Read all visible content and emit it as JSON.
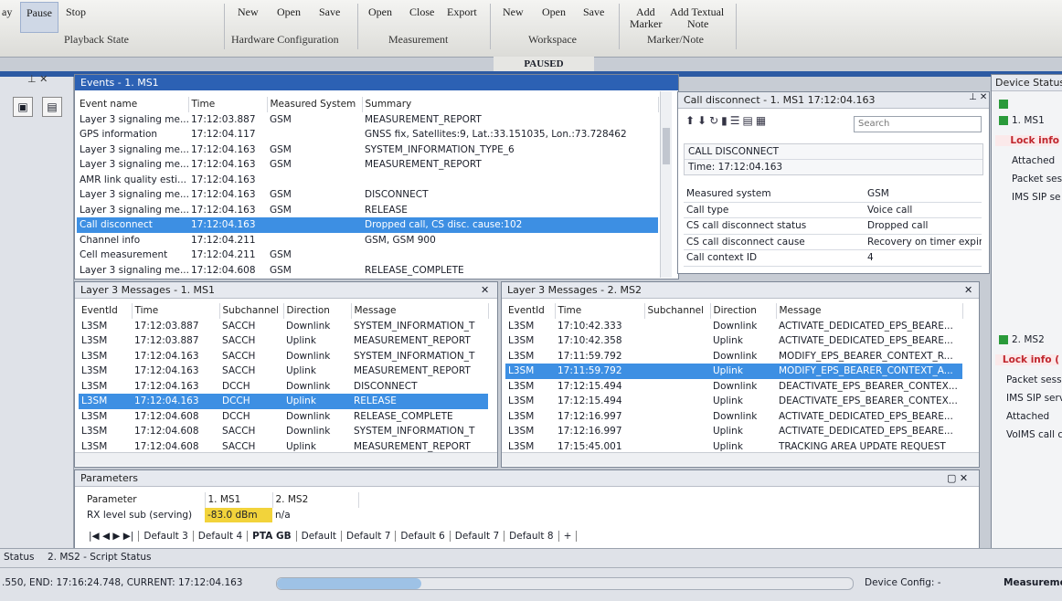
{
  "ribbon": {
    "left_cut": "ay",
    "pause": "Pause",
    "stop": "Stop",
    "playback_state": "Playback State",
    "hw_new": "New",
    "hw_open": "Open",
    "hw_save": "Save",
    "hardware_configuration": "Hardware Configuration",
    "m_open": "Open",
    "m_close": "Close",
    "m_export": "Export",
    "measurement": "Measurement",
    "ws_new": "New",
    "ws_open": "Open",
    "ws_save": "Save",
    "workspace": "Workspace",
    "add_marker_1": "Add",
    "add_marker_2": "Marker",
    "add_text_1": "Add Textual",
    "add_text_2": "Note",
    "marker_note": "Marker/Note",
    "state": "PAUSED"
  },
  "events": {
    "title": "Events - 1. MS1",
    "headers": [
      "Event name",
      "Time",
      "Measured System",
      "Summary"
    ],
    "rows": [
      [
        "Layer 3 signaling me...",
        "17:12:03.887",
        "GSM",
        "MEASUREMENT_REPORT"
      ],
      [
        "GPS information",
        "17:12:04.117",
        "",
        "GNSS fix, Satellites:9, Lat.:33.151035, Lon.:73.728462"
      ],
      [
        "Layer 3 signaling me...",
        "17:12:04.163",
        "GSM",
        "SYSTEM_INFORMATION_TYPE_6"
      ],
      [
        "Layer 3 signaling me...",
        "17:12:04.163",
        "GSM",
        "MEASUREMENT_REPORT"
      ],
      [
        "AMR link quality esti...",
        "17:12:04.163",
        "",
        ""
      ],
      [
        "Layer 3 signaling me...",
        "17:12:04.163",
        "GSM",
        "DISCONNECT"
      ],
      [
        "Layer 3 signaling me...",
        "17:12:04.163",
        "GSM",
        "RELEASE"
      ],
      [
        "Call disconnect",
        "17:12:04.163",
        "",
        "Dropped call, CS disc. cause:102"
      ],
      [
        "Channel info",
        "17:12:04.211",
        "",
        "GSM, GSM 900"
      ],
      [
        "Cell measurement",
        "17:12:04.211",
        "GSM",
        ""
      ],
      [
        "Layer 3 signaling me...",
        "17:12:04.608",
        "GSM",
        "RELEASE_COMPLETE"
      ]
    ]
  },
  "call_disconnect": {
    "title": "Call disconnect - 1. MS1  17:12:04.163",
    "search_placeholder": "Search",
    "header1": "CALL DISCONNECT",
    "header2": "Time: 17:12:04.163",
    "rows": [
      [
        "Measured system",
        "GSM"
      ],
      [
        "Call type",
        "Voice call"
      ],
      [
        "CS call disconnect status",
        "Dropped call"
      ],
      [
        "CS call disconnect cause",
        "Recovery on timer expiry"
      ],
      [
        "Call context ID",
        "4"
      ]
    ]
  },
  "l3_ms1": {
    "title": "Layer 3 Messages - 1. MS1",
    "headers": [
      "EventId",
      "Time",
      "Subchannel",
      "Direction",
      "Message"
    ],
    "rows": [
      [
        "L3SM",
        "17:12:03.887",
        "SACCH",
        "Downlink",
        "SYSTEM_INFORMATION_T"
      ],
      [
        "L3SM",
        "17:12:03.887",
        "SACCH",
        "Uplink",
        "MEASUREMENT_REPORT"
      ],
      [
        "L3SM",
        "17:12:04.163",
        "SACCH",
        "Downlink",
        "SYSTEM_INFORMATION_T"
      ],
      [
        "L3SM",
        "17:12:04.163",
        "SACCH",
        "Uplink",
        "MEASUREMENT_REPORT"
      ],
      [
        "L3SM",
        "17:12:04.163",
        "DCCH",
        "Downlink",
        "DISCONNECT"
      ],
      [
        "L3SM",
        "17:12:04.163",
        "DCCH",
        "Uplink",
        "RELEASE"
      ],
      [
        "L3SM",
        "17:12:04.608",
        "DCCH",
        "Downlink",
        "RELEASE_COMPLETE"
      ],
      [
        "L3SM",
        "17:12:04.608",
        "SACCH",
        "Downlink",
        "SYSTEM_INFORMATION_T"
      ],
      [
        "L3SM",
        "17:12:04.608",
        "SACCH",
        "Uplink",
        "MEASUREMENT_REPORT"
      ]
    ]
  },
  "l3_ms2": {
    "title": "Layer 3 Messages - 2. MS2",
    "headers": [
      "EventId",
      "Time",
      "Subchannel",
      "Direction",
      "Message"
    ],
    "rows": [
      [
        "L3SM",
        "17:10:42.333",
        "",
        "Downlink",
        "ACTIVATE_DEDICATED_EPS_BEARE..."
      ],
      [
        "L3SM",
        "17:10:42.358",
        "",
        "Uplink",
        "ACTIVATE_DEDICATED_EPS_BEARE..."
      ],
      [
        "L3SM",
        "17:11:59.792",
        "",
        "Downlink",
        "MODIFY_EPS_BEARER_CONTEXT_R..."
      ],
      [
        "L3SM",
        "17:11:59.792",
        "",
        "Uplink",
        "MODIFY_EPS_BEARER_CONTEXT_A..."
      ],
      [
        "L3SM",
        "17:12:15.494",
        "",
        "Downlink",
        "DEACTIVATE_EPS_BEARER_CONTEX..."
      ],
      [
        "L3SM",
        "17:12:15.494",
        "",
        "Uplink",
        "DEACTIVATE_EPS_BEARER_CONTEX..."
      ],
      [
        "L3SM",
        "17:12:16.997",
        "",
        "Downlink",
        "ACTIVATE_DEDICATED_EPS_BEARE..."
      ],
      [
        "L3SM",
        "17:12:16.997",
        "",
        "Uplink",
        "ACTIVATE_DEDICATED_EPS_BEARE..."
      ],
      [
        "L3SM",
        "17:15:45.001",
        "",
        "Uplink",
        "TRACKING AREA UPDATE REQUEST"
      ]
    ]
  },
  "parameters": {
    "title": "Parameters",
    "headers": [
      "Parameter",
      "1. MS1",
      "2. MS2"
    ],
    "row": [
      "RX level sub (serving)",
      "-83.0 dBm",
      "n/a"
    ],
    "tabs": [
      "Default 3",
      "Default 4",
      "PTA GB",
      "Default",
      "Default 7",
      "Default 6",
      "Default 7",
      "Default 8",
      "+"
    ]
  },
  "device_status": {
    "title": "Device Status",
    "ms1": "1. MS1",
    "ms1_items": [
      "Lock info",
      "Attached",
      "Packet ses",
      "IMS SIP se"
    ],
    "ms2": "2. MS2",
    "ms2_items": [
      "Lock info (",
      "Packet sess",
      "IMS SIP serv",
      "Attached",
      "VoIMS call c"
    ]
  },
  "status": {
    "label": "Status",
    "script": "2. MS2 - Script Status",
    "range": ".550, END: 17:16:24.748, CURRENT: 17:12:04.163",
    "device_config": "Device Config: -",
    "measurement": "Measureme"
  },
  "colors": {
    "accent_blue": "#2c61b4",
    "selection_blue": "#3d8fe3",
    "status_green": "#2a9a3a",
    "lock_red": "#c0262d"
  }
}
